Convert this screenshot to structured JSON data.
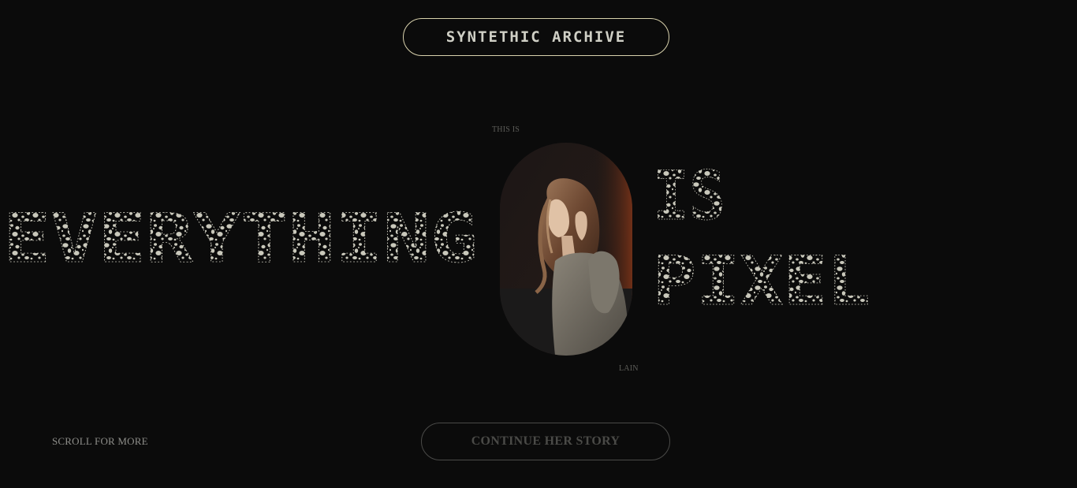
{
  "header": {
    "title": "SYNTETHIC ARCHIVE"
  },
  "hero": {
    "eyebrow": "THIS IS",
    "word_left": "EVERYTHING",
    "word_right_top": "IS",
    "word_right_bottom": "PIXEL",
    "caption": "LAIN",
    "portrait_icon": "portrait-photo-icon"
  },
  "footer": {
    "scroll_label": "SCROLL FOR MORE",
    "cta_label": "CONTINUE HER STORY"
  },
  "colors": {
    "background": "#0b0b0b",
    "header_border": "#d9d2ad",
    "speckle": "#c9c8bb"
  }
}
